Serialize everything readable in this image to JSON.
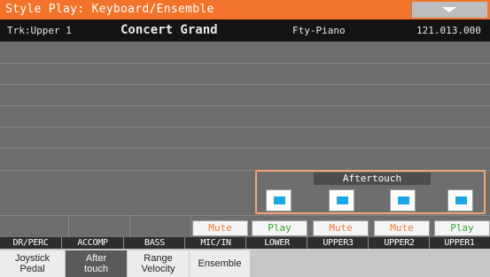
{
  "window": {
    "title": "Style Play: Keyboard/Ensemble"
  },
  "header": {
    "track": "Trk:Upper 1",
    "sound": "Concert Grand",
    "bank": "Fty-Piano",
    "program_number": "121.013.000"
  },
  "aftertouch": {
    "label": "Aftertouch",
    "buttons": [
      {
        "channel": "LOWER",
        "on": true
      },
      {
        "channel": "UPPER3",
        "on": true
      },
      {
        "channel": "UPPER2",
        "on": true
      },
      {
        "channel": "UPPER1",
        "on": true
      }
    ]
  },
  "channels": [
    {
      "name": "DR/PERC",
      "state": ""
    },
    {
      "name": "ACCOMP",
      "state": ""
    },
    {
      "name": "BASS",
      "state": ""
    },
    {
      "name": "MIC/IN",
      "state": "Mute"
    },
    {
      "name": "LOWER",
      "state": "Play"
    },
    {
      "name": "UPPER3",
      "state": "Mute"
    },
    {
      "name": "UPPER2",
      "state": "Mute"
    },
    {
      "name": "UPPER1",
      "state": "Play"
    }
  ],
  "tabs": [
    {
      "line1": "Joystick",
      "line2": "Pedal"
    },
    {
      "line1": "After",
      "line2": "touch",
      "active": true
    },
    {
      "line1": "Range",
      "line2": "Velocity"
    },
    {
      "line1": "Ensemble",
      "line2": ""
    }
  ],
  "colors": {
    "title_bar": "#f2742a",
    "mute_text": "#f07a36",
    "play_text": "#2fa32f",
    "led": "#1ba6e6"
  },
  "icons": {
    "menu": "chevron-down-icon"
  }
}
